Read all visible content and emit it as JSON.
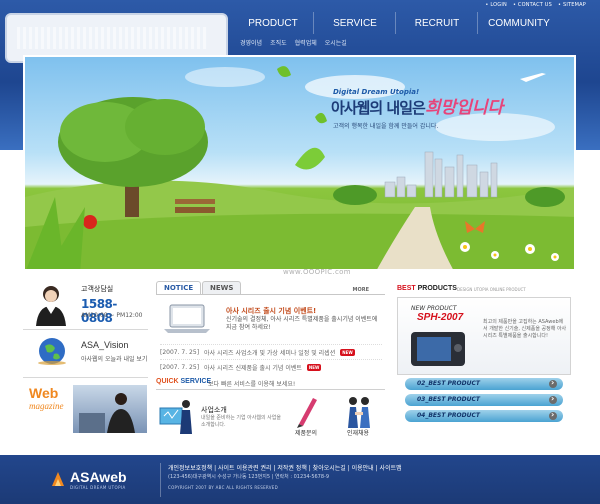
{
  "header": {
    "topbar": [
      "• LOGIN",
      "• CONTACT US",
      "• SITEMAP"
    ],
    "nav": [
      "PRODUCT",
      "SERVICE",
      "RECRUIT",
      "COMMUNITY"
    ],
    "sub_menu": [
      "경영이념",
      "조직도",
      "협력업체",
      "오시는길"
    ]
  },
  "hero": {
    "subtitle": "Digital Dream Utopia!",
    "main_text": "아사웹의 내일은",
    "accent_text": "희망입니다",
    "desc": "고객의 행복한 내일을 함께 만들어 갑니다."
  },
  "watermark": "www.OOOPIC.com",
  "customer_center": {
    "title": "고객상담실",
    "phone": "1588-0808",
    "hours": "AM10:00 ~ PM12:00"
  },
  "vision": {
    "title": "ASA_Vision",
    "desc": "아사웹의 오늘과 내일 보기"
  },
  "web_magazine": {
    "title": "Web",
    "sub": "magazine"
  },
  "notice": {
    "tabs": [
      "NOTICE",
      "NEWS"
    ],
    "more": "MORE",
    "headline": "아사 시리즈 출시 기념 이벤트!",
    "body": "신기술의 결정체, 아사 시리즈 특별제품을 출시기념 이벤트에 지금 참여 하세요!",
    "items": [
      {
        "date": "[2007. 7. 25]",
        "text": "아사 시리즈 사업소개 및 가상 세미나 일정 및 리셉션",
        "badge": "NEW"
      },
      {
        "date": "[2007. 7. 25]",
        "text": "아사 시리즈 신제품을 출시 기념 이벤트",
        "badge": "NEW"
      }
    ]
  },
  "quick_service": {
    "title_a": "QUICK",
    "title_b": "SERVICE",
    "desc": "보다 빠른 서비스를 이용해 보세요!",
    "item1_title": "사업소개",
    "item1_desc": "내일을 준비하는 기업 아사웹의 사업을 소개합니다.",
    "item2_label": "제품문의",
    "item3_label": "인재채용"
  },
  "best_products": {
    "title_a": "BEST",
    "title_b": "PRODUCTS",
    "sub": "DESIGN UTOPIA ONLINE PRODUCT",
    "new_product": "NEW PRODUCT",
    "model": "SPH-2007",
    "desc": "최고의 제품만을 고집하는 ASAweb에서 개발한 신기술, 신제품을 공정해 아사 시리즈 특별제품을 출시합니다!",
    "items": [
      "02_BEST PRODUCT",
      "03_BEST PRODUCT",
      "04_BEST PRODUCT"
    ]
  },
  "footer": {
    "logo": "ASAweb",
    "logo_sub": "DIGITAL DREAM UTOPIA",
    "links": "개인정보보호정책 | 사이트 이용관련 권리 | 저작권 정책 | 찾아오시는길 | 이용안내 | 사이트맵",
    "address": "(123-456)대구광역시 수성구 가나동 123번지5 | 연락처 : 01234-5678-9",
    "copyright": "COPYRIGHT 2007 BY ABC ALL RIGHTS RESERVED"
  },
  "colors": {
    "header_blue": "#1e4690",
    "accent_pink": "#e7447a",
    "phone_blue": "#1b5cb0",
    "magazine_orange": "#f08820",
    "new_red": "#d6101c"
  }
}
